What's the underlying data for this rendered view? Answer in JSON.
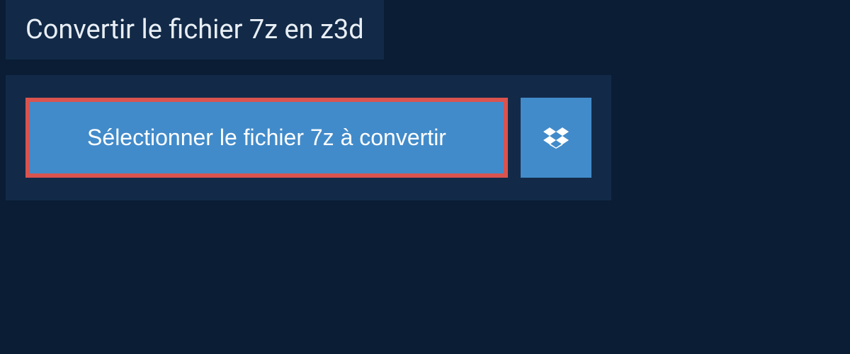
{
  "header": {
    "title": "Convertir le fichier 7z en z3d"
  },
  "upload": {
    "select_button_label": "Sélectionner le fichier 7z à convertir"
  }
}
